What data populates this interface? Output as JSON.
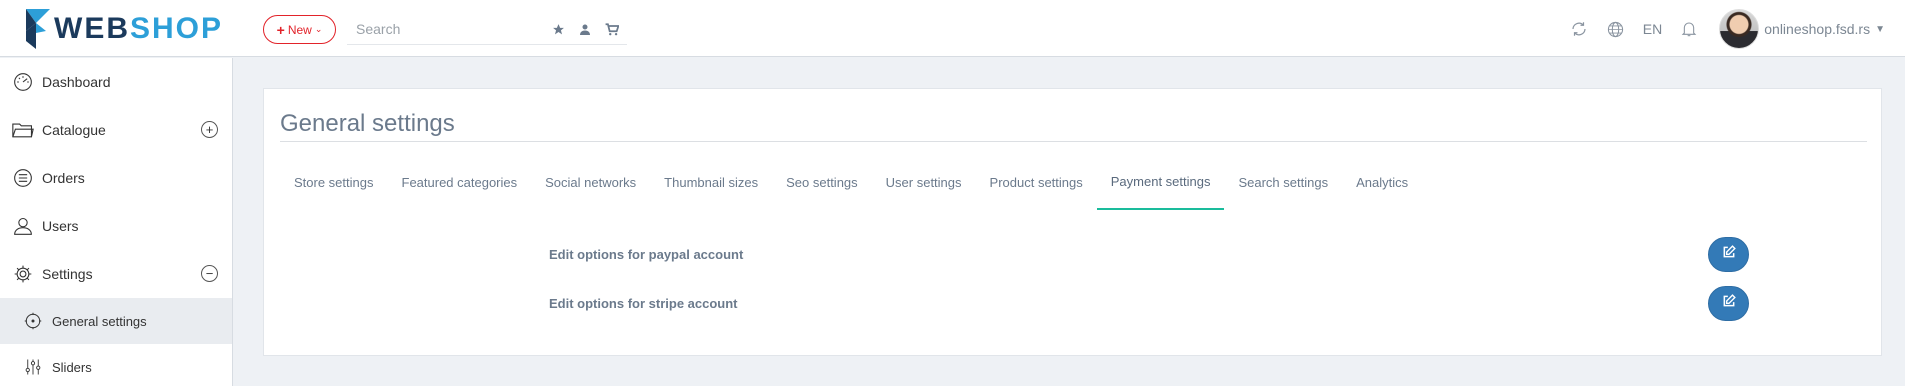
{
  "header": {
    "logo": {
      "part1": "WEB",
      "part2": "SHOP"
    },
    "new_button": {
      "label": "New"
    },
    "search": {
      "placeholder": "Search",
      "value": ""
    },
    "search_icons": [
      "star-icon",
      "user-icon",
      "cart-icon"
    ],
    "right": {
      "icons": [
        "refresh-icon",
        "globe-icon",
        "bell-icon"
      ],
      "language": "EN",
      "user_name": "onlineshop.fsd.rs"
    }
  },
  "sidebar": {
    "items": [
      {
        "label": "Dashboard",
        "icon": "dashboard-icon"
      },
      {
        "label": "Catalogue",
        "icon": "folder-icon",
        "toggle": "+"
      },
      {
        "label": "Orders",
        "icon": "list-icon"
      },
      {
        "label": "Users",
        "icon": "user-icon"
      },
      {
        "label": "Settings",
        "icon": "gear-icon",
        "toggle": "−"
      },
      {
        "label": "General settings",
        "icon": "cog-circle-icon",
        "active": true
      },
      {
        "label": "Sliders",
        "icon": "sliders-icon"
      }
    ]
  },
  "main": {
    "title": "General settings",
    "tabs": [
      {
        "label": "Store settings"
      },
      {
        "label": "Featured categories"
      },
      {
        "label": "Social networks"
      },
      {
        "label": "Thumbnail sizes"
      },
      {
        "label": "Seo settings"
      },
      {
        "label": "User settings"
      },
      {
        "label": "Product settings"
      },
      {
        "label": "Payment settings",
        "active": true
      },
      {
        "label": "Search settings"
      },
      {
        "label": "Analytics"
      }
    ],
    "options": [
      {
        "label": "Edit options for paypal account",
        "button_icon": "edit-icon"
      },
      {
        "label": "Edit options for stripe account",
        "button_icon": "edit-icon"
      }
    ]
  },
  "colors": {
    "brand_dark": "#1b3a5c",
    "brand_light": "#2d9fd8",
    "new_red": "#e2232a",
    "tab_active_underline": "#1abc9c",
    "button_blue": "#337ab7",
    "page_bg": "#eef1f5"
  }
}
